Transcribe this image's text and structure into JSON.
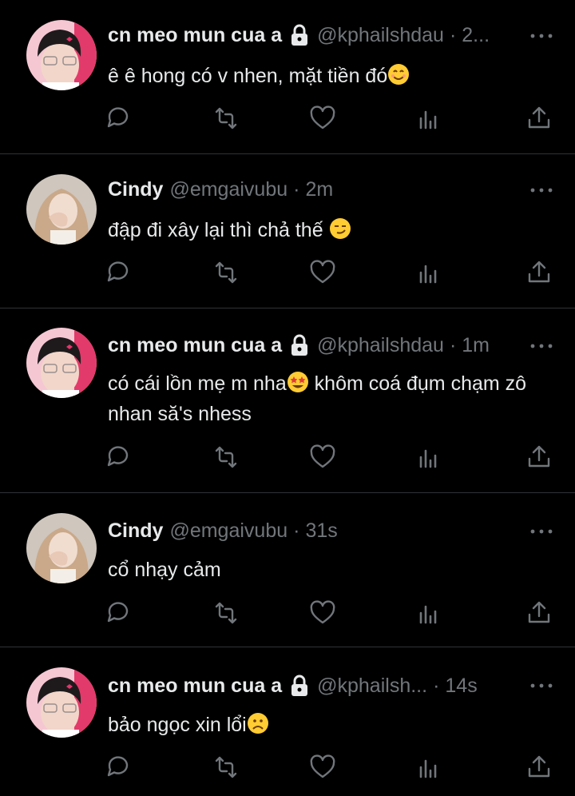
{
  "theme": {
    "background": "#000000",
    "text": "#e7e9ea",
    "muted": "#71767b",
    "divider": "#2f3336"
  },
  "tweets": [
    {
      "display_name": "cn meo mun cua a",
      "locked": true,
      "handle": "@kphailshdau",
      "time": "2...",
      "text": "ê ê hong có v nhen, mặt tiền đó",
      "emoji": "smiling-face-emoji",
      "avatar": "boy-avatar"
    },
    {
      "display_name": "Cindy",
      "locked": false,
      "handle": "@emgaivubu",
      "time": "2m",
      "text": "đập đi xây lại thì chả thế ",
      "emoji": "smirking-face-emoji",
      "avatar": "girl-avatar"
    },
    {
      "display_name": "cn meo mun cua a",
      "locked": true,
      "handle": "@kphailshdau",
      "time": "1m",
      "text_before_emoji": "có cái lồn mẹ m nha",
      "text_after_emoji": " khôm coá đụm chạm zô nhan să's nhess",
      "emoji": "star-struck-emoji",
      "avatar": "boy-avatar"
    },
    {
      "display_name": "Cindy",
      "locked": false,
      "handle": "@emgaivubu",
      "time": "31s",
      "text": "cổ nhạy cảm",
      "avatar": "girl-avatar"
    },
    {
      "display_name": "cn meo mun cua a",
      "locked": true,
      "handle": "@kphailsh...",
      "time": "14s",
      "text": "bảo ngọc xin lổi",
      "emoji": "frowning-face-emoji",
      "avatar": "boy-avatar"
    }
  ],
  "actions": [
    "reply-icon",
    "retweet-icon",
    "like-icon",
    "views-icon",
    "share-icon"
  ]
}
